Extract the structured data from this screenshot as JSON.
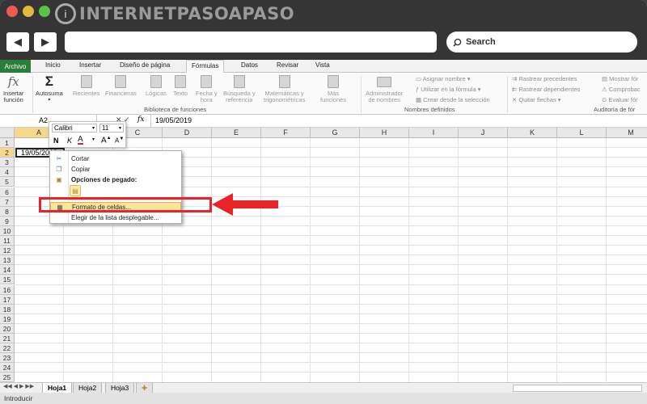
{
  "window": {
    "logo_text": "INTERNETPASOAPASO",
    "search_label": "Search",
    "colors": {
      "titlebar": "#353535",
      "file_tab": "#2a7d3c",
      "arrow": "#e8232a"
    }
  },
  "ribbon_tabs": [
    "Archivo",
    "Inicio",
    "Insertar",
    "Diseño de página",
    "Fórmulas",
    "Datos",
    "Revisar",
    "Vista"
  ],
  "ribbon": {
    "insert_function": [
      "Insertar",
      "función"
    ],
    "autosum": "Autosuma",
    "recientes": "Recientes",
    "financieras": "Financieras",
    "logicas": "Lógicas",
    "texto": "Texto",
    "fecha": [
      "Fecha y",
      "hora"
    ],
    "busqueda": [
      "Búsqueda y",
      "referencia"
    ],
    "matematicas": [
      "Matemáticas y",
      "trigonométricas"
    ],
    "mas": [
      "Más",
      "funciones"
    ],
    "administrador": [
      "Administrador",
      "de nombres"
    ],
    "asignar": "Asignar nombre",
    "utilizar": "Utilizar en la fórmula",
    "crear": "Crear desde la selección",
    "rastrear_prec": "Rastrear precedentes",
    "rastrear_dep": "Rastrear dependientes",
    "quitar": "Quitar flechas",
    "mostrar": "Mostrar fór",
    "comprobar": "Comprobac",
    "evaluar": "Evaluar fór",
    "group_biblioteca": "Biblioteca de funciones",
    "group_nombres": "Nombres definidos",
    "group_auditoria": "Auditoría de fór"
  },
  "formula_bar": {
    "namebox": "A2",
    "fx": "fx",
    "value": "19/05/2019"
  },
  "columns": [
    "A",
    "B",
    "C",
    "D",
    "E",
    "F",
    "G",
    "H",
    "I",
    "J",
    "K",
    "L",
    "M"
  ],
  "rows": [
    "1",
    "2",
    "3",
    "4",
    "5",
    "6",
    "7",
    "8",
    "9",
    "10",
    "11",
    "12",
    "13",
    "14",
    "15",
    "16",
    "17",
    "18",
    "19",
    "20",
    "21",
    "22",
    "23",
    "24",
    "25"
  ],
  "cell_a2": "19/05/2019",
  "mini_toolbar": {
    "font": "Calibri",
    "size": "11",
    "bold": "N",
    "italic": "K",
    "font_color": "A",
    "grow": "A",
    "shrink": "A"
  },
  "context_menu": {
    "cut": "Cortar",
    "copy": "Copiar",
    "paste_options": "Opciones de pegado:",
    "format_cells": "Formato de celdas...",
    "pick_list": "Elegir de la lista desplegable..."
  },
  "sheet_tabs": [
    "Hoja1",
    "Hoja2",
    "Hoja3"
  ],
  "status": "Introducir"
}
